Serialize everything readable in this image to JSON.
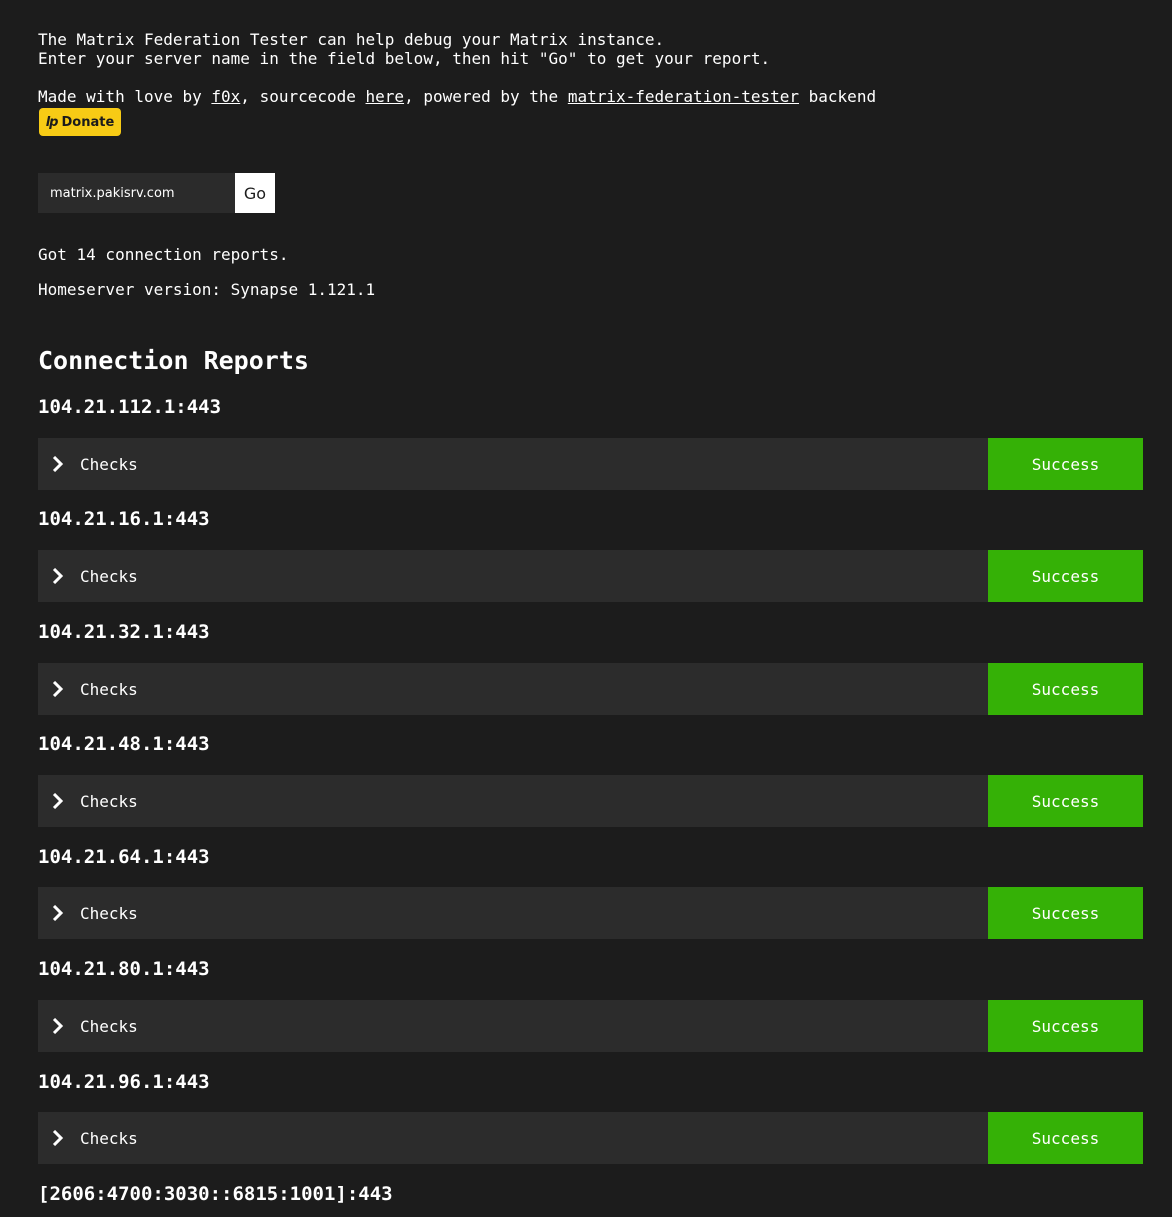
{
  "intro": {
    "line1": "The Matrix Federation Tester can help debug your Matrix instance.",
    "line2": "Enter your server name in the field below, then hit \"Go\" to get your report."
  },
  "credits": {
    "prefix": "Made with love by ",
    "author": "f0x",
    "mid1": ", sourcecode ",
    "source_link": "here",
    "mid2": ", powered by the ",
    "backend_link": "matrix-federation-tester",
    "suffix": " backend"
  },
  "donate": {
    "logo": "lp",
    "label": "Donate",
    "color": "#f7cb15"
  },
  "form": {
    "server_value": "matrix.pakisrv.com",
    "go_label": "Go"
  },
  "summary": {
    "reports": "Got 14 connection reports.",
    "version": "Homeserver version: Synapse 1.121.1"
  },
  "section_title": "Connection Reports",
  "colors": {
    "background": "#1c1c1c",
    "row": "#2c2c2c",
    "success": "#35b106"
  },
  "reports": [
    {
      "host": "104.21.112.1:443",
      "checks_label": "Checks",
      "status": "Success"
    },
    {
      "host": "104.21.16.1:443",
      "checks_label": "Checks",
      "status": "Success"
    },
    {
      "host": "104.21.32.1:443",
      "checks_label": "Checks",
      "status": "Success"
    },
    {
      "host": "104.21.48.1:443",
      "checks_label": "Checks",
      "status": "Success"
    },
    {
      "host": "104.21.64.1:443",
      "checks_label": "Checks",
      "status": "Success"
    },
    {
      "host": "104.21.80.1:443",
      "checks_label": "Checks",
      "status": "Success"
    },
    {
      "host": "104.21.96.1:443",
      "checks_label": "Checks",
      "status": "Success"
    },
    {
      "host": "[2606:4700:3030::6815:1001]:443"
    }
  ]
}
